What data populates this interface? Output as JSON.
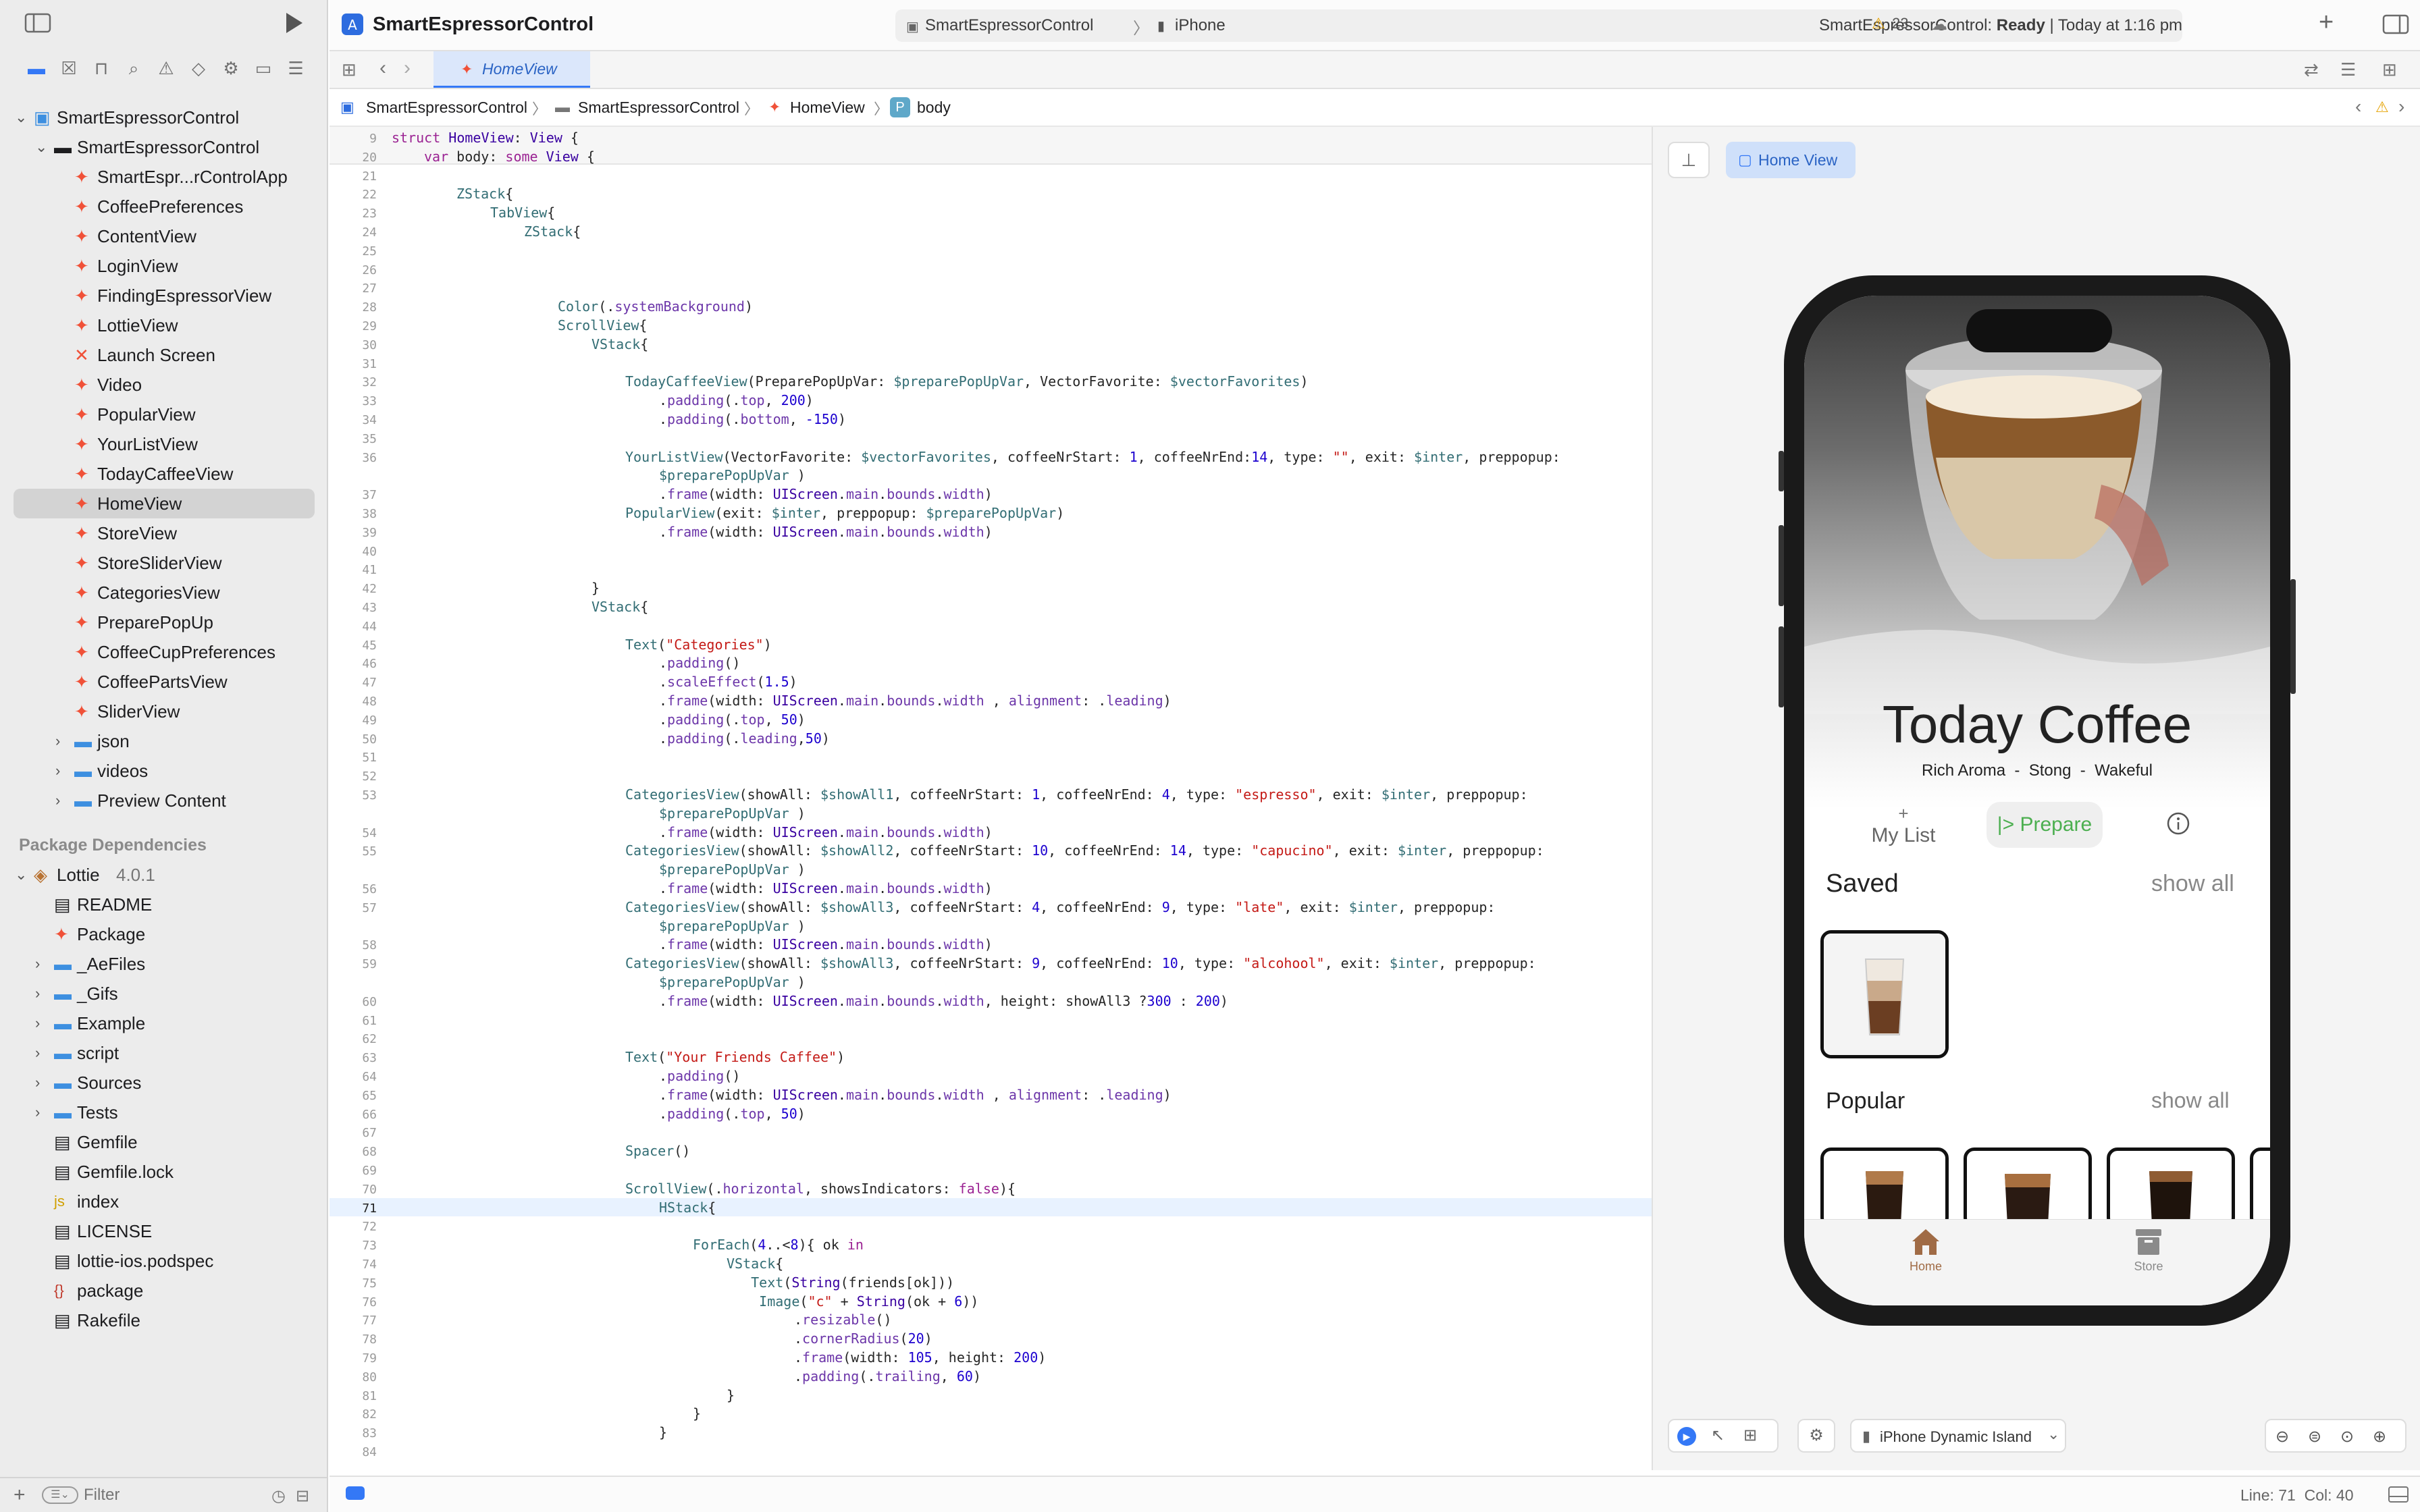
{
  "window": {
    "app_title": "SmartEspressorControl",
    "scheme": "SmartEspressorControl",
    "device": "iPhone",
    "status_prefix": "SmartEspressorControl: ",
    "status_ready": "Ready",
    "status_time": " | Today at 1:16 pm",
    "warnings": "23",
    "editor_tab": "HomeView"
  },
  "navigator": {
    "project": "SmartEspressorControl",
    "group": "SmartEspressorControl",
    "files": [
      {
        "label": "SmartEspr...rControlApp",
        "kind": "swift"
      },
      {
        "label": "CoffeePreferences",
        "kind": "swift"
      },
      {
        "label": "ContentView",
        "kind": "swift"
      },
      {
        "label": "LoginView",
        "kind": "swift"
      },
      {
        "label": "FindingEspressorView",
        "kind": "swift"
      },
      {
        "label": "LottieView",
        "kind": "swift"
      },
      {
        "label": "Launch Screen",
        "kind": "xib"
      },
      {
        "label": "Video",
        "kind": "swift"
      },
      {
        "label": "PopularView",
        "kind": "swift"
      },
      {
        "label": "YourListView",
        "kind": "swift"
      },
      {
        "label": "TodayCaffeeView",
        "kind": "swift"
      },
      {
        "label": "HomeView",
        "kind": "swift",
        "selected": true
      },
      {
        "label": "StoreView",
        "kind": "swift"
      },
      {
        "label": "StoreSliderView",
        "kind": "swift"
      },
      {
        "label": "CategoriesView",
        "kind": "swift"
      },
      {
        "label": "PreparePopUp",
        "kind": "swift"
      },
      {
        "label": "CoffeeCupPreferences",
        "kind": "swift"
      },
      {
        "label": "CoffeePartsView",
        "kind": "swift"
      },
      {
        "label": "SliderView",
        "kind": "swift"
      }
    ],
    "folders": [
      "json",
      "videos",
      "Preview Content"
    ],
    "deps_header": "Package Dependencies",
    "lottie": "Lottie",
    "lottie_version": "4.0.1",
    "lottie_items": [
      {
        "label": "README",
        "kind": "doc"
      },
      {
        "label": "Package",
        "kind": "swift"
      },
      {
        "label": "_AeFiles",
        "kind": "folder"
      },
      {
        "label": "_Gifs",
        "kind": "folder"
      },
      {
        "label": "Example",
        "kind": "folder"
      },
      {
        "label": "script",
        "kind": "folder"
      },
      {
        "label": "Sources",
        "kind": "folder"
      },
      {
        "label": "Tests",
        "kind": "folder"
      },
      {
        "label": "Gemfile",
        "kind": "doc"
      },
      {
        "label": "Gemfile.lock",
        "kind": "doc"
      },
      {
        "label": "index",
        "kind": "js"
      },
      {
        "label": "LICENSE",
        "kind": "doc"
      },
      {
        "label": "lottie-ios.podspec",
        "kind": "doc"
      },
      {
        "label": "package",
        "kind": "json"
      },
      {
        "label": "Rakefile",
        "kind": "doc"
      }
    ],
    "filter_placeholder": "Filter"
  },
  "jumpbar": [
    "SmartEspressorControl",
    "SmartEspressorControl",
    "HomeView",
    "body"
  ],
  "code_lines": [
    {
      "n": "9",
      "i": 0,
      "h": "<span class='kw'>struct</span> <span class='ty'>HomeView</span>: <span class='ty'>View</span> {"
    },
    {
      "n": "20",
      "i": 1,
      "h": "<span class='kw'>var</span> body: <span class='kw'>some</span> <span class='ty'>View</span> {"
    },
    {
      "n": "21",
      "i": 0,
      "h": ""
    },
    {
      "n": "22",
      "i": 2,
      "h": "<span class='fn'>ZStack</span>{"
    },
    {
      "n": "23",
      "i": 3,
      "h": "<span class='fn'>TabView</span>{"
    },
    {
      "n": "24",
      "i": 4,
      "h": "<span class='fn'>ZStack</span>{"
    },
    {
      "n": "25",
      "i": 0,
      "h": ""
    },
    {
      "n": "26",
      "i": 0,
      "h": ""
    },
    {
      "n": "27",
      "i": 0,
      "h": ""
    },
    {
      "n": "28",
      "i": 5,
      "h": "<span class='fn'>Color</span>(.<span class='pr'>systemBackground</span>)"
    },
    {
      "n": "29",
      "i": 5,
      "h": "<span class='fn'>ScrollView</span>{"
    },
    {
      "n": "30",
      "i": 6,
      "h": "<span class='fn'>VStack</span>{"
    },
    {
      "n": "31",
      "i": 0,
      "h": ""
    },
    {
      "n": "32",
      "i": 7,
      "h": "<span class='fn'>TodayCaffeeView</span>(PreparePopUpVar: <span class='fn'>$preparePopUpVar</span>, VectorFavorite: <span class='fn'>$vectorFavorites</span>)"
    },
    {
      "n": "33",
      "i": 8,
      "h": ".<span class='pr'>padding</span>(.<span class='pr'>top</span>, <span class='nu'>200</span>)"
    },
    {
      "n": "34",
      "i": 8,
      "h": ".<span class='pr'>padding</span>(.<span class='pr'>bottom</span>, <span class='nu'>-150</span>)"
    },
    {
      "n": "35",
      "i": 0,
      "h": ""
    },
    {
      "n": "36",
      "i": 7,
      "h": "<span class='fn'>YourListView</span>(VectorFavorite: <span class='fn'>$vectorFavorites</span>, coffeeNrStart: <span class='nu'>1</span>, coffeeNrEnd:<span class='nu'>14</span>, type: <span class='st'>\"\"</span>, exit: <span class='fn'>$inter</span>, preppopup:"
    },
    {
      "n": "",
      "i": 8,
      "h": "<span class='fn'>$preparePopUpVar</span> )"
    },
    {
      "n": "37",
      "i": 8,
      "h": ".<span class='pr'>frame</span>(width: <span class='ty'>UIScreen</span>.<span class='pr'>main</span>.<span class='pr'>bounds</span>.<span class='pr'>width</span>)"
    },
    {
      "n": "38",
      "i": 7,
      "h": "<span class='fn'>PopularView</span>(exit: <span class='fn'>$inter</span>, preppopup: <span class='fn'>$preparePopUpVar</span>)"
    },
    {
      "n": "39",
      "i": 8,
      "h": ".<span class='pr'>frame</span>(width: <span class='ty'>UIScreen</span>.<span class='pr'>main</span>.<span class='pr'>bounds</span>.<span class='pr'>width</span>)"
    },
    {
      "n": "40",
      "i": 0,
      "h": ""
    },
    {
      "n": "41",
      "i": 0,
      "h": ""
    },
    {
      "n": "42",
      "i": 6,
      "h": "}"
    },
    {
      "n": "43",
      "i": 6,
      "h": "<span class='fn'>VStack</span>{"
    },
    {
      "n": "44",
      "i": 0,
      "h": ""
    },
    {
      "n": "45",
      "i": 7,
      "h": "<span class='fn'>Text</span>(<span class='st'>\"Categories\"</span>)"
    },
    {
      "n": "46",
      "i": 8,
      "h": ".<span class='pr'>padding</span>()"
    },
    {
      "n": "47",
      "i": 8,
      "h": ".<span class='pr'>scaleEffect</span>(<span class='nu'>1.5</span>)"
    },
    {
      "n": "48",
      "i": 8,
      "h": ".<span class='pr'>frame</span>(width: <span class='ty'>UIScreen</span>.<span class='pr'>main</span>.<span class='pr'>bounds</span>.<span class='pr'>width</span> , <span class='pr'>alignment</span>: .<span class='pr'>leading</span>)"
    },
    {
      "n": "49",
      "i": 8,
      "h": ".<span class='pr'>padding</span>(.<span class='pr'>top</span>, <span class='nu'>50</span>)"
    },
    {
      "n": "50",
      "i": 8,
      "h": ".<span class='pr'>padding</span>(.<span class='pr'>leading</span>,<span class='nu'>50</span>)"
    },
    {
      "n": "51",
      "i": 0,
      "h": ""
    },
    {
      "n": "52",
      "i": 0,
      "h": ""
    },
    {
      "n": "53",
      "i": 7,
      "h": "<span class='fn'>CategoriesView</span>(showAll: <span class='fn'>$showAll1</span>, coffeeNrStart: <span class='nu'>1</span>, coffeeNrEnd: <span class='nu'>4</span>, type: <span class='st'>\"espresso\"</span>, exit: <span class='fn'>$inter</span>, preppopup:"
    },
    {
      "n": "",
      "i": 8,
      "h": "<span class='fn'>$preparePopUpVar</span> )"
    },
    {
      "n": "54",
      "i": 8,
      "h": ".<span class='pr'>frame</span>(width: <span class='ty'>UIScreen</span>.<span class='pr'>main</span>.<span class='pr'>bounds</span>.<span class='pr'>width</span>)"
    },
    {
      "n": "55",
      "i": 7,
      "h": "<span class='fn'>CategoriesView</span>(showAll: <span class='fn'>$showAll2</span>, coffeeNrStart: <span class='nu'>10</span>, coffeeNrEnd: <span class='nu'>14</span>, type: <span class='st'>\"capucino\"</span>, exit: <span class='fn'>$inter</span>, preppopup:"
    },
    {
      "n": "",
      "i": 8,
      "h": "<span class='fn'>$preparePopUpVar</span> )"
    },
    {
      "n": "56",
      "i": 8,
      "h": ".<span class='pr'>frame</span>(width: <span class='ty'>UIScreen</span>.<span class='pr'>main</span>.<span class='pr'>bounds</span>.<span class='pr'>width</span>)"
    },
    {
      "n": "57",
      "i": 7,
      "h": "<span class='fn'>CategoriesView</span>(showAll: <span class='fn'>$showAll3</span>, coffeeNrStart: <span class='nu'>4</span>, coffeeNrEnd: <span class='nu'>9</span>, type: <span class='st'>\"late\"</span>, exit: <span class='fn'>$inter</span>, preppopup:"
    },
    {
      "n": "",
      "i": 8,
      "h": "<span class='fn'>$preparePopUpVar</span> )"
    },
    {
      "n": "58",
      "i": 8,
      "h": ".<span class='pr'>frame</span>(width: <span class='ty'>UIScreen</span>.<span class='pr'>main</span>.<span class='pr'>bounds</span>.<span class='pr'>width</span>)"
    },
    {
      "n": "59",
      "i": 7,
      "h": "<span class='fn'>CategoriesView</span>(showAll: <span class='fn'>$showAll3</span>, coffeeNrStart: <span class='nu'>9</span>, coffeeNrEnd: <span class='nu'>10</span>, type: <span class='st'>\"alcohool\"</span>, exit: <span class='fn'>$inter</span>, preppopup:"
    },
    {
      "n": "",
      "i": 8,
      "h": "<span class='fn'>$preparePopUpVar</span> )"
    },
    {
      "n": "60",
      "i": 8,
      "h": ".<span class='pr'>frame</span>(width: <span class='ty'>UIScreen</span>.<span class='pr'>main</span>.<span class='pr'>bounds</span>.<span class='pr'>width</span>, height: showAll3 ?<span class='nu'>300</span> : <span class='nu'>200</span>)"
    },
    {
      "n": "61",
      "i": 0,
      "h": ""
    },
    {
      "n": "62",
      "i": 0,
      "h": ""
    },
    {
      "n": "63",
      "i": 7,
      "h": "<span class='fn'>Text</span>(<span class='st'>\"Your Friends Caffee\"</span>)"
    },
    {
      "n": "64",
      "i": 8,
      "h": ".<span class='pr'>padding</span>()"
    },
    {
      "n": "65",
      "i": 8,
      "h": ".<span class='pr'>frame</span>(width: <span class='ty'>UIScreen</span>.<span class='pr'>main</span>.<span class='pr'>bounds</span>.<span class='pr'>width</span> , <span class='pr'>alignment</span>: .<span class='pr'>leading</span>)"
    },
    {
      "n": "66",
      "i": 8,
      "h": ".<span class='pr'>padding</span>(.<span class='pr'>top</span>, <span class='nu'>50</span>)"
    },
    {
      "n": "67",
      "i": 0,
      "h": ""
    },
    {
      "n": "68",
      "i": 7,
      "h": "<span class='fn'>Spacer</span>()"
    },
    {
      "n": "69",
      "i": 0,
      "h": ""
    },
    {
      "n": "70",
      "i": 7,
      "h": "<span class='fn'>ScrollView</span>(.<span class='pr'>horizontal</span>, showsIndicators: <span class='kw'>false</span>){"
    },
    {
      "n": "71",
      "i": 8,
      "h": "<span class='fn'>HStack</span>{",
      "cur": true
    },
    {
      "n": "72",
      "i": 0,
      "h": ""
    },
    {
      "n": "73",
      "i": 9,
      "h": "<span class='fn'>ForEach</span>(<span class='nu'>4</span>..&lt;<span class='nu'>8</span>){ ok <span class='kw'>in</span>"
    },
    {
      "n": "74",
      "i": 10,
      "h": "<span class='fn'>VStack</span>{"
    },
    {
      "n": "75",
      "i": 10,
      "h": "   <span class='fn'>Text</span>(<span class='ty'>String</span>(friends[ok]))"
    },
    {
      "n": "76",
      "i": 10,
      "h": "    <span class='fn'>Image</span>(<span class='st'>\"c\"</span> + <span class='ty'>String</span>(ok + <span class='nu'>6</span>))"
    },
    {
      "n": "77",
      "i": 12,
      "h": ".<span class='pr'>resizable</span>()"
    },
    {
      "n": "78",
      "i": 12,
      "h": ".<span class='pr'>cornerRadius</span>(<span class='nu'>20</span>)"
    },
    {
      "n": "79",
      "i": 12,
      "h": ".<span class='pr'>frame</span>(width: <span class='nu'>105</span>, height: <span class='nu'>200</span>)"
    },
    {
      "n": "80",
      "i": 12,
      "h": ".<span class='pr'>padding</span>(.<span class='pr'>trailing</span>, <span class='nu'>60</span>)"
    },
    {
      "n": "81",
      "i": 10,
      "h": "}"
    },
    {
      "n": "82",
      "i": 9,
      "h": "}"
    },
    {
      "n": "83",
      "i": 8,
      "h": "}"
    },
    {
      "n": "84",
      "i": 0,
      "h": ""
    }
  ],
  "canvas": {
    "preview_tab": "Home View",
    "device_select": "iPhone Dynamic Island"
  },
  "app": {
    "hero_title": "Today Coffee",
    "hero_subtitle": "Rich Aroma  -  Stong  -  Wakeful",
    "mylist_plus": "+",
    "mylist": "My List",
    "prepare": "|> Prepare",
    "saved": "Saved",
    "show_all_saved": "show all",
    "popular": "Popular",
    "show_all_popular": "show all",
    "tab_home": "Home",
    "tab_store": "Store"
  },
  "status": {
    "cursor": "Line: 71  Col: 40"
  },
  "colors": {
    "accent": "#3478f6",
    "prepare_green": "#4caf50",
    "warning": "#f5a623"
  }
}
